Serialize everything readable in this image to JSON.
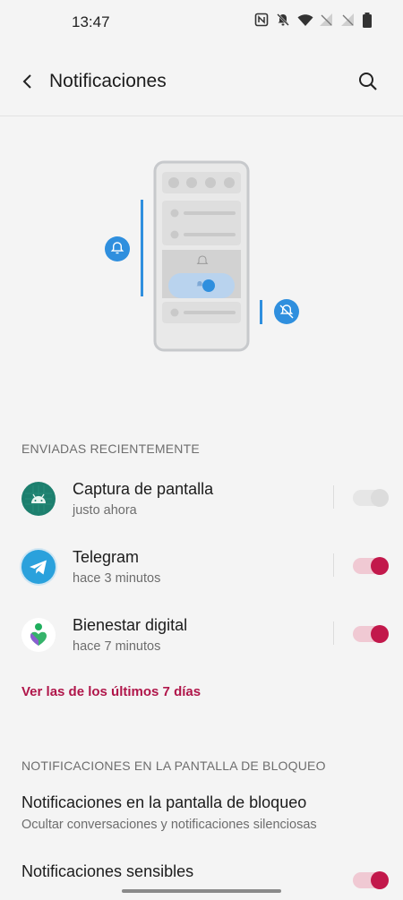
{
  "status_bar": {
    "time": "13:47"
  },
  "header": {
    "title": "Notificaciones"
  },
  "recent": {
    "section_title": "ENVIADAS RECIENTEMENTE",
    "apps": [
      {
        "name": "Captura de pantalla",
        "time": "justo ahora",
        "enabled": false,
        "icon": "android-icon"
      },
      {
        "name": "Telegram",
        "time": "hace 3 minutos",
        "enabled": true,
        "icon": "telegram-icon"
      },
      {
        "name": "Bienestar digital",
        "time": "hace 7 minutos",
        "enabled": true,
        "icon": "digital-wellbeing-icon"
      }
    ],
    "see_more": "Ver las de los últimos 7 días"
  },
  "lockscreen": {
    "section_title": "NOTIFICACIONES EN LA PANTALLA DE BLOQUEO",
    "item1_title": "Notificaciones en la pantalla de bloqueo",
    "item1_sub": "Ocultar conversaciones y notificaciones silenciosas",
    "item2_title": "Notificaciones sensibles",
    "item2_enabled": true
  },
  "colors": {
    "accent": "#c2184b",
    "link": "#b0164a",
    "illustration_blue": "#2f8fde"
  }
}
